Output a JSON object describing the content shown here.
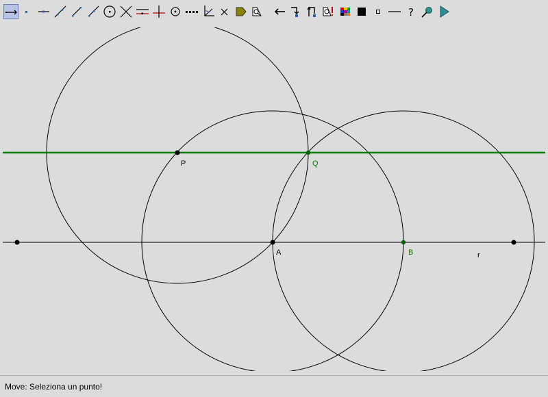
{
  "toolbar": {
    "tools": [
      {
        "name": "move-tool-icon",
        "active": true
      },
      {
        "name": "point-tool-icon"
      },
      {
        "name": "point-on-line-tool-icon"
      },
      {
        "name": "line-tool-icon"
      },
      {
        "name": "segment-tool-icon"
      },
      {
        "name": "ray-tool-icon"
      },
      {
        "name": "circle-tool-icon"
      },
      {
        "name": "intersection-tool-icon"
      },
      {
        "name": "parallel-line-tool-icon"
      },
      {
        "name": "perpendicular-line-tool-icon"
      },
      {
        "name": "midpoint-tool-icon"
      },
      {
        "name": "dotted-line-tool-icon"
      },
      {
        "name": "angle-tool-icon"
      },
      {
        "name": "delete-tool-icon"
      },
      {
        "name": "polygon-fill-tool-icon"
      },
      {
        "name": "measure-tool-icon"
      },
      {
        "name": "undo-tool-icon"
      },
      {
        "name": "macro-record-tool-icon"
      },
      {
        "name": "macro-play-tool-icon"
      },
      {
        "name": "find-tool-icon"
      },
      {
        "name": "color-palette-icon"
      },
      {
        "name": "filled-square-icon"
      },
      {
        "name": "small-square-icon"
      },
      {
        "name": "line-style-icon"
      },
      {
        "name": "help-icon"
      },
      {
        "name": "zoom-tool-icon"
      },
      {
        "name": "play-tool-icon"
      }
    ]
  },
  "canvas": {
    "points": {
      "P": "P",
      "Q": "Q",
      "A": "A",
      "B": "B",
      "r": "r"
    }
  },
  "status": {
    "message": "Move: Seleziona un punto!"
  },
  "colors": {
    "green_line": "#008000",
    "green_point": "#006400",
    "black": "#000000",
    "background": "#dcdcdc"
  }
}
